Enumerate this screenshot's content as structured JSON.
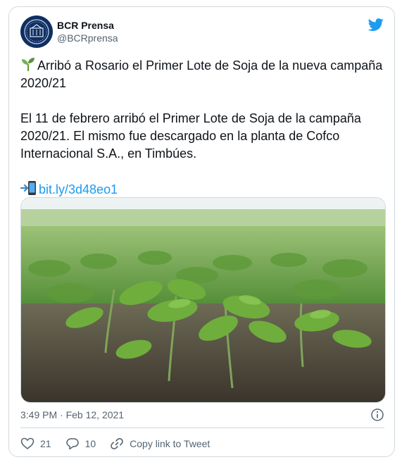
{
  "author": {
    "display_name": "BCR Prensa",
    "handle": "@BCRprensa"
  },
  "tweet": {
    "headline": "Arribó a Rosario el Primer Lote de Soja de la nueva campaña 2020/21",
    "body": "El 11 de febrero arribó el Primer Lote de Soja de la campaña 2020/21. El mismo fue descargado en la planta de Cofco Internacional S.A., en Timbúes.",
    "link": "bit.ly/3d48eo1",
    "timestamp": "3:49 PM · Feb 12, 2021"
  },
  "actions": {
    "likes": "21",
    "replies": "10",
    "copy_link": "Copy link to Tweet"
  },
  "icons": [
    "seedling-icon",
    "mobile-arrow-icon",
    "twitter-bird-icon",
    "info-icon",
    "heart-icon",
    "reply-icon",
    "link-icon"
  ],
  "colors": {
    "accent": "#1d9bf0",
    "text": "#0f1419",
    "muted": "#536471",
    "border": "#cfd9de",
    "avatar_bg": "#0e2f63"
  }
}
